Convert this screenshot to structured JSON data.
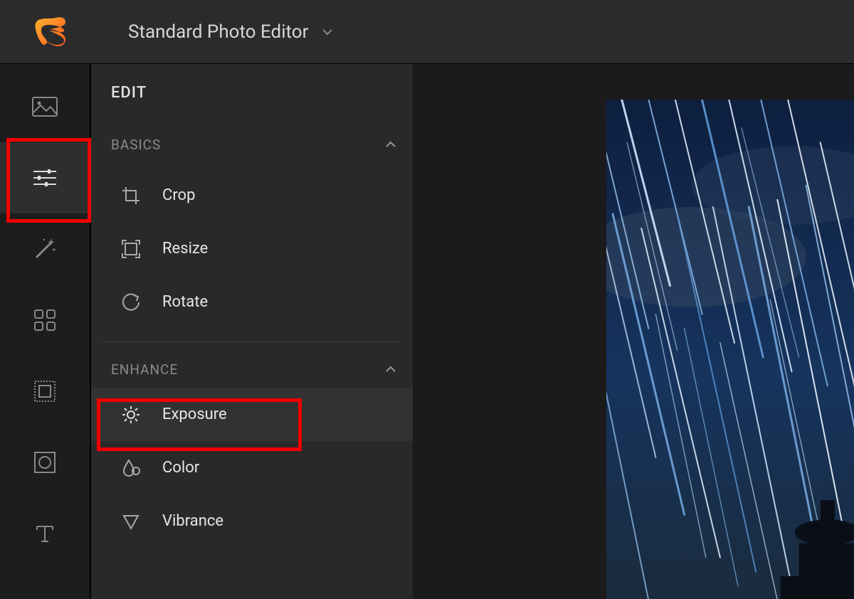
{
  "header": {
    "title": "Standard Photo Editor"
  },
  "panel": {
    "title": "EDIT",
    "sections": [
      {
        "label": "BASICS",
        "items": [
          {
            "label": "Crop"
          },
          {
            "label": "Resize"
          },
          {
            "label": "Rotate"
          }
        ]
      },
      {
        "label": "ENHANCE",
        "items": [
          {
            "label": "Exposure"
          },
          {
            "label": "Color"
          },
          {
            "label": "Vibrance"
          }
        ]
      }
    ]
  }
}
